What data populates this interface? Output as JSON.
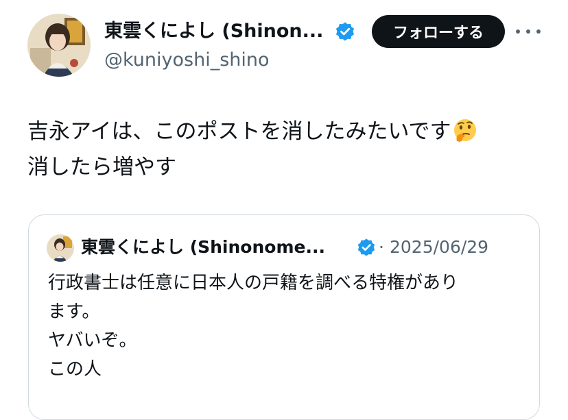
{
  "author": {
    "display_name": "東雲くによし (Shinon...",
    "handle": "@kuniyoshi_shino"
  },
  "actions": {
    "follow_label": "フォローする"
  },
  "post": {
    "line1": "吉永アイは、このポストを消したみたいです",
    "line2": "消したら増やす",
    "emoji_icon": "thinking-face-emoji"
  },
  "quoted_post": {
    "display_name": "東雲くによし (Shinonome...",
    "separator": "·",
    "date": "2025/06/29",
    "lines": [
      "行政書士は任意に日本人の戸籍を調べる特権があり",
      "ます。",
      "ヤバいぞ。",
      "この人"
    ]
  },
  "colors": {
    "text_primary": "#0f1419",
    "text_secondary": "#536471",
    "verified_blue": "#1d9bf0",
    "button_bg": "#0f1419",
    "card_border": "#cfd9de"
  }
}
